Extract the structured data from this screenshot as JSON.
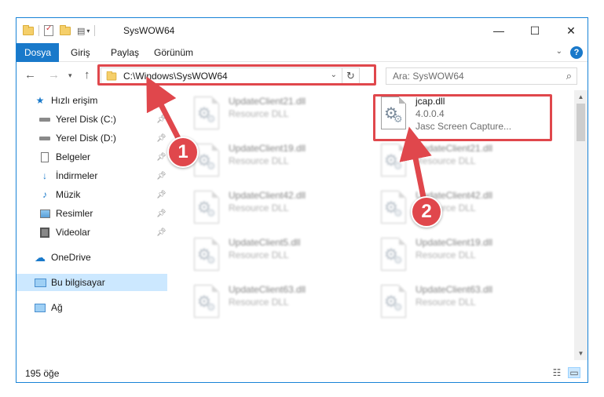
{
  "window": {
    "title": "SysWOW64"
  },
  "ribbon": {
    "tabs": [
      "Dosya",
      "Giriş",
      "Paylaş",
      "Görünüm"
    ],
    "help": "?"
  },
  "nav": {
    "address": "C:\\Windows\\SysWOW64",
    "search_placeholder": "Ara: SysWOW64"
  },
  "sidebar": {
    "items": [
      {
        "label": "Hızlı erişim",
        "icon": "star-icon"
      },
      {
        "label": "Yerel Disk (C:)",
        "icon": "drive-icon",
        "pinned": true
      },
      {
        "label": "Yerel Disk (D:)",
        "icon": "drive-icon",
        "pinned": true
      },
      {
        "label": "Belgeler",
        "icon": "document-icon",
        "pinned": true
      },
      {
        "label": "İndirmeler",
        "icon": "download-icon",
        "pinned": true
      },
      {
        "label": "Müzik",
        "icon": "music-icon",
        "pinned": true
      },
      {
        "label": "Resimler",
        "icon": "pictures-icon",
        "pinned": true
      },
      {
        "label": "Videolar",
        "icon": "video-icon",
        "pinned": true
      },
      {
        "label": "OneDrive",
        "icon": "cloud-icon"
      },
      {
        "label": "Bu bilgisayar",
        "icon": "computer-icon",
        "selected": true
      },
      {
        "label": "Ağ",
        "icon": "network-icon"
      }
    ]
  },
  "files": {
    "left": [
      {
        "name": "UpdateClient21.dll",
        "type": "Resource DLL"
      },
      {
        "name": "UpdateClient19.dll",
        "type": "Resource DLL"
      },
      {
        "name": "UpdateClient42.dll",
        "type": "Resource DLL"
      },
      {
        "name": "UpdateClient5.dll",
        "type": "Resource DLL"
      },
      {
        "name": "UpdateClient63.dll",
        "type": "Resource DLL"
      }
    ],
    "right": [
      {
        "name": "jcap.dll",
        "version": "4.0.0.4",
        "type": "Jasc Screen Capture..."
      },
      {
        "name": "UpdateClient21.dll",
        "type": "Resource DLL"
      },
      {
        "name": "UpdateClient42.dll",
        "type": "Resource DLL"
      },
      {
        "name": "UpdateClient19.dll",
        "type": "Resource DLL"
      },
      {
        "name": "UpdateClient63.dll",
        "type": "Resource DLL"
      }
    ]
  },
  "status": {
    "count": "195 öğe"
  },
  "annotations": {
    "badge1": "1",
    "badge2": "2",
    "color": "#e0474c"
  }
}
